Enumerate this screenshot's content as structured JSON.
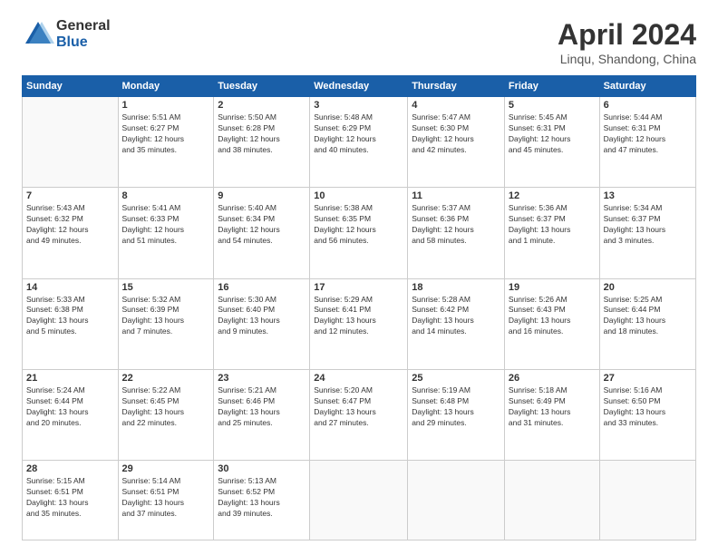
{
  "header": {
    "logo_general": "General",
    "logo_blue": "Blue",
    "month": "April 2024",
    "location": "Linqu, Shandong, China"
  },
  "days_of_week": [
    "Sunday",
    "Monday",
    "Tuesday",
    "Wednesday",
    "Thursday",
    "Friday",
    "Saturday"
  ],
  "weeks": [
    [
      {
        "day": "",
        "info": ""
      },
      {
        "day": "1",
        "info": "Sunrise: 5:51 AM\nSunset: 6:27 PM\nDaylight: 12 hours\nand 35 minutes."
      },
      {
        "day": "2",
        "info": "Sunrise: 5:50 AM\nSunset: 6:28 PM\nDaylight: 12 hours\nand 38 minutes."
      },
      {
        "day": "3",
        "info": "Sunrise: 5:48 AM\nSunset: 6:29 PM\nDaylight: 12 hours\nand 40 minutes."
      },
      {
        "day": "4",
        "info": "Sunrise: 5:47 AM\nSunset: 6:30 PM\nDaylight: 12 hours\nand 42 minutes."
      },
      {
        "day": "5",
        "info": "Sunrise: 5:45 AM\nSunset: 6:31 PM\nDaylight: 12 hours\nand 45 minutes."
      },
      {
        "day": "6",
        "info": "Sunrise: 5:44 AM\nSunset: 6:31 PM\nDaylight: 12 hours\nand 47 minutes."
      }
    ],
    [
      {
        "day": "7",
        "info": "Sunrise: 5:43 AM\nSunset: 6:32 PM\nDaylight: 12 hours\nand 49 minutes."
      },
      {
        "day": "8",
        "info": "Sunrise: 5:41 AM\nSunset: 6:33 PM\nDaylight: 12 hours\nand 51 minutes."
      },
      {
        "day": "9",
        "info": "Sunrise: 5:40 AM\nSunset: 6:34 PM\nDaylight: 12 hours\nand 54 minutes."
      },
      {
        "day": "10",
        "info": "Sunrise: 5:38 AM\nSunset: 6:35 PM\nDaylight: 12 hours\nand 56 minutes."
      },
      {
        "day": "11",
        "info": "Sunrise: 5:37 AM\nSunset: 6:36 PM\nDaylight: 12 hours\nand 58 minutes."
      },
      {
        "day": "12",
        "info": "Sunrise: 5:36 AM\nSunset: 6:37 PM\nDaylight: 13 hours\nand 1 minute."
      },
      {
        "day": "13",
        "info": "Sunrise: 5:34 AM\nSunset: 6:37 PM\nDaylight: 13 hours\nand 3 minutes."
      }
    ],
    [
      {
        "day": "14",
        "info": "Sunrise: 5:33 AM\nSunset: 6:38 PM\nDaylight: 13 hours\nand 5 minutes."
      },
      {
        "day": "15",
        "info": "Sunrise: 5:32 AM\nSunset: 6:39 PM\nDaylight: 13 hours\nand 7 minutes."
      },
      {
        "day": "16",
        "info": "Sunrise: 5:30 AM\nSunset: 6:40 PM\nDaylight: 13 hours\nand 9 minutes."
      },
      {
        "day": "17",
        "info": "Sunrise: 5:29 AM\nSunset: 6:41 PM\nDaylight: 13 hours\nand 12 minutes."
      },
      {
        "day": "18",
        "info": "Sunrise: 5:28 AM\nSunset: 6:42 PM\nDaylight: 13 hours\nand 14 minutes."
      },
      {
        "day": "19",
        "info": "Sunrise: 5:26 AM\nSunset: 6:43 PM\nDaylight: 13 hours\nand 16 minutes."
      },
      {
        "day": "20",
        "info": "Sunrise: 5:25 AM\nSunset: 6:44 PM\nDaylight: 13 hours\nand 18 minutes."
      }
    ],
    [
      {
        "day": "21",
        "info": "Sunrise: 5:24 AM\nSunset: 6:44 PM\nDaylight: 13 hours\nand 20 minutes."
      },
      {
        "day": "22",
        "info": "Sunrise: 5:22 AM\nSunset: 6:45 PM\nDaylight: 13 hours\nand 22 minutes."
      },
      {
        "day": "23",
        "info": "Sunrise: 5:21 AM\nSunset: 6:46 PM\nDaylight: 13 hours\nand 25 minutes."
      },
      {
        "day": "24",
        "info": "Sunrise: 5:20 AM\nSunset: 6:47 PM\nDaylight: 13 hours\nand 27 minutes."
      },
      {
        "day": "25",
        "info": "Sunrise: 5:19 AM\nSunset: 6:48 PM\nDaylight: 13 hours\nand 29 minutes."
      },
      {
        "day": "26",
        "info": "Sunrise: 5:18 AM\nSunset: 6:49 PM\nDaylight: 13 hours\nand 31 minutes."
      },
      {
        "day": "27",
        "info": "Sunrise: 5:16 AM\nSunset: 6:50 PM\nDaylight: 13 hours\nand 33 minutes."
      }
    ],
    [
      {
        "day": "28",
        "info": "Sunrise: 5:15 AM\nSunset: 6:51 PM\nDaylight: 13 hours\nand 35 minutes."
      },
      {
        "day": "29",
        "info": "Sunrise: 5:14 AM\nSunset: 6:51 PM\nDaylight: 13 hours\nand 37 minutes."
      },
      {
        "day": "30",
        "info": "Sunrise: 5:13 AM\nSunset: 6:52 PM\nDaylight: 13 hours\nand 39 minutes."
      },
      {
        "day": "",
        "info": ""
      },
      {
        "day": "",
        "info": ""
      },
      {
        "day": "",
        "info": ""
      },
      {
        "day": "",
        "info": ""
      }
    ]
  ]
}
